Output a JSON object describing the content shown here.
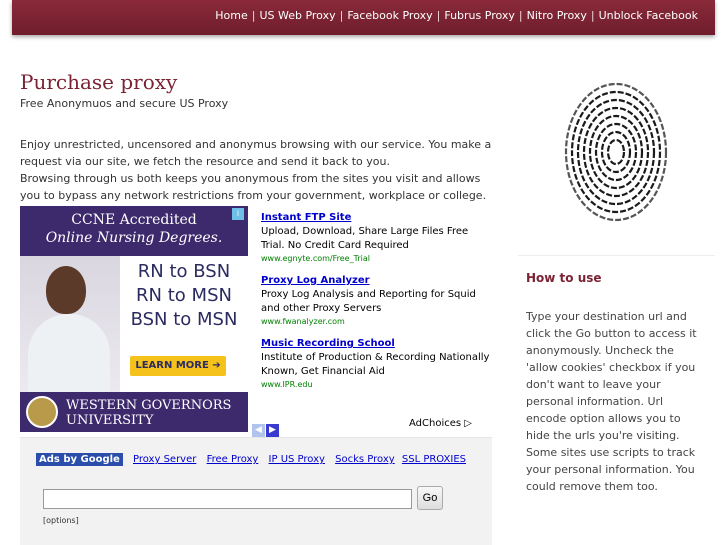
{
  "topnav": [
    {
      "label": "Home"
    },
    {
      "label": "US Web Proxy"
    },
    {
      "label": "Facebook Proxy"
    },
    {
      "label": "Fubrus Proxy"
    },
    {
      "label": "Nitro Proxy"
    },
    {
      "label": "Unblock Facebook"
    }
  ],
  "main": {
    "title": "Purchase proxy",
    "subtitle": "Free Anonymuos and secure US Proxy",
    "intro1": "Enjoy unrestricted, uncensored and anonymus browsing with our service. You make a request via our site, we fetch the resource and send it back to you.",
    "intro2": "Browsing through us both keeps you anonymous from the sites you visit and allows you to bypass any network restrictions from your government, workplace or college."
  },
  "banner": {
    "line1": "CCNE Accredited",
    "line2": "Online Nursing Degrees.",
    "deg1": "RN to BSN",
    "deg2": "RN to MSN",
    "deg3": "BSN to MSN",
    "cta": "LEARN MORE ➔",
    "uni1": "WESTERN GOVERNORS",
    "uni2": "UNIVERSITY"
  },
  "textads": [
    {
      "title": "Instant FTP Site",
      "desc": "Upload, Download, Share Large Files Free Trial. No Credit Card Required",
      "url": "www.egnyte.com/Free_Trial"
    },
    {
      "title": "Proxy Log Analyzer",
      "desc": "Proxy Log Analysis and Reporting for Squid and other Proxy Servers",
      "url": "www.fwanalyzer.com"
    },
    {
      "title": "Music Recording School",
      "desc": "Institute of Production & Recording Nationally Known, Get Financial Aid",
      "url": "www.IPR.edu"
    }
  ],
  "adchoices": "AdChoices ▷",
  "linkunit": {
    "ads_by": "Ads by Google",
    "links": [
      "Proxy Server",
      "Free Proxy",
      "IP US Proxy",
      "Socks Proxy",
      "SSL PROXIES"
    ]
  },
  "search": {
    "value": "",
    "go_label": "Go",
    "options_label": "[options]"
  },
  "sidebar": {
    "title": "How to use",
    "text": "Type your destination url and click the Go button to access it anonymously. Uncheck the 'allow cookies' checkbox if you don't want to leave your personal information. Url encode option allows you to hide the urls you're visiting. Some sites use scripts to track your personal information. You could remove them too."
  }
}
